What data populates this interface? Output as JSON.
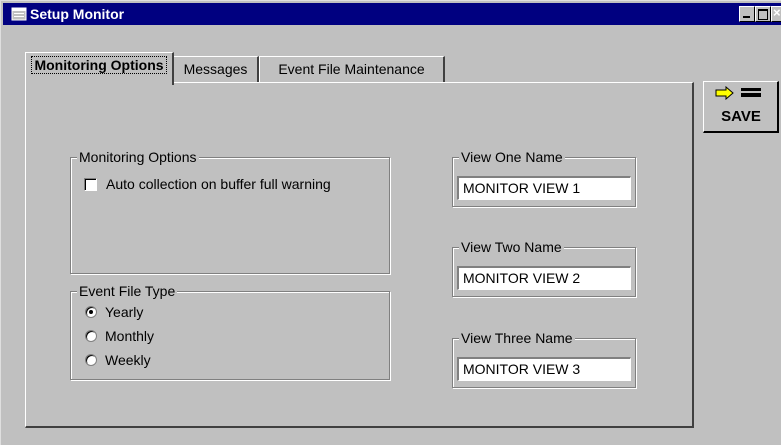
{
  "window": {
    "title": "Setup Monitor",
    "close_glyph": "×"
  },
  "tabs": [
    {
      "label": "Monitoring Options",
      "active": true
    },
    {
      "label": "Messages",
      "active": false
    },
    {
      "label": "Event File Maintenance",
      "active": false
    }
  ],
  "monitoring_group": {
    "label": "Monitoring Options",
    "auto_collection": {
      "label": "Auto collection on buffer full warning",
      "checked": false
    }
  },
  "event_file_type": {
    "label": "Event File Type",
    "options": [
      {
        "label": "Yearly",
        "checked": true
      },
      {
        "label": "Monthly",
        "checked": false
      },
      {
        "label": "Weekly",
        "checked": false
      }
    ]
  },
  "views": [
    {
      "label": "View One Name",
      "value": "MONITOR VIEW  1"
    },
    {
      "label": "View Two Name",
      "value": "MONITOR VIEW  2"
    },
    {
      "label": "View Three Name",
      "value": "MONITOR VIEW  3"
    }
  ],
  "save_button": {
    "label": "SAVE",
    "icon": "arrow-save-icon"
  },
  "colors": {
    "titlebar": "#000080",
    "face": "#c0c0c0",
    "arrow": "#ffff00"
  }
}
